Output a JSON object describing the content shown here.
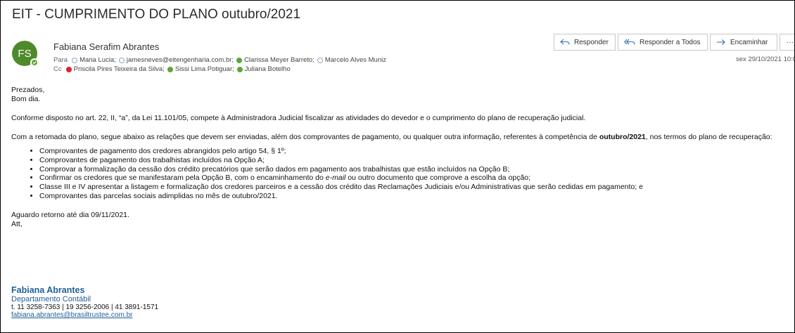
{
  "email": {
    "subject": "EIT - CUMPRIMENTO DO PLANO outubro/2021",
    "avatar_initials": "FS",
    "sender": "Fabiana  Serafim Abrantes",
    "to_label": "Para",
    "to": [
      {
        "name": "Maria Lucia;",
        "status": "none"
      },
      {
        "name": "jamesneves@eitengenharia.com.br;",
        "status": "none"
      },
      {
        "name": "Clarissa Meyer  Barreto;",
        "status": "available"
      },
      {
        "name": "Marcelo Alves Muniz",
        "status": "none"
      }
    ],
    "cc_label": "Cc",
    "cc": [
      {
        "name": "Priscila Pires Teixeira da Silva;",
        "status": "busy"
      },
      {
        "name": "Sissi Lima Potiguar;",
        "status": "available"
      },
      {
        "name": "Juliana Botelho",
        "status": "available"
      }
    ],
    "date": "sex 29/10/2021 10:0"
  },
  "toolbar": {
    "reply_label": "Responder",
    "reply_all_label": "Responder a Todos",
    "forward_label": "Encaminhar",
    "more_label": "···"
  },
  "body": {
    "greeting1": "Prezados,",
    "greeting2": "Bom dia.",
    "para1": "Conforme disposto no art. 22, II, “a”, da Lei 11.101/05, compete à Administradora Judicial fiscalizar as atividades do devedor e o cumprimento do plano de recuperação judicial.",
    "para2_before": "Com a retomada do plano, segue abaixo as relações que devem ser enviadas, além dos comprovantes de pagamento, ou qualquer outra informação, referentes à competência de ",
    "para2_bold": "outubro/2021",
    "para2_after": ", nos termos do plano de recuperação:",
    "item1": "Comprovantes de pagamento dos credores abrangidos pelo artigo 54, § 1º;",
    "item2": "Comprovantes de pagamento dos trabalhistas incluídos na Opção A;",
    "item3": "Comprovar a formalização da cessão dos crédito precatórios que serão dados em pagamento aos trabalhistas que estão incluídos na Opção B;",
    "item4_before": "Confirmar os credores que se manifestaram pela Opção B, com o encaminhamento do ",
    "item4_italic": "e-mail",
    "item4_after": " ou outro documento que comprove a escolha da opção;",
    "item5": "Classe III e IV apresentar a listagem e formalização dos credores parceiros e a cessão dos crédito das Reclamações Judiciais e/ou Administrativas que serão cedidas em pagamento; e",
    "item6": "Comprovantes das parcelas sociais adimplidas no mês de outubro/2021.",
    "closing1": "Aguardo retorno até dia 09/11/2021.",
    "closing2": "Att,"
  },
  "signature": {
    "name": "Fabiana Abrantes",
    "department": "Departamento Contábil",
    "phones": "t. 11 3258-7363 | 19 3256-2006 | 41 3891-1571",
    "email": "fabiana.abrantes@brasiltrustee.com.br"
  },
  "colors": {
    "avatar": "#4e8a2a",
    "available": "#5ea53a",
    "busy": "#d9252c",
    "signature": "#1f5f9a",
    "accent": "#2b6cb0"
  }
}
